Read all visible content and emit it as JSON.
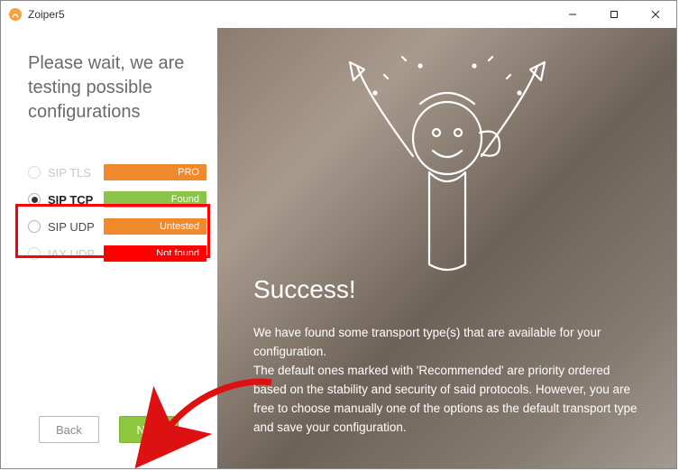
{
  "window": {
    "title": "Zoiper5"
  },
  "left": {
    "heading": "Please wait, we are testing possible configurations",
    "configs": [
      {
        "label": "SIP TLS",
        "status": "PRO",
        "color": "orange",
        "disabled": true,
        "selected": false
      },
      {
        "label": "SIP TCP",
        "status": "Found",
        "color": "green",
        "disabled": false,
        "selected": true
      },
      {
        "label": "SIP UDP",
        "status": "Untested",
        "color": "orange",
        "disabled": false,
        "selected": false
      },
      {
        "label": "IAX UDP",
        "status": "Not found",
        "color": "red",
        "disabled": true,
        "selected": false
      }
    ],
    "back_label": "Back",
    "next_label": "Next"
  },
  "right": {
    "title": "Success!",
    "body_line1": "We have found some transport type(s) that are available for your configuration.",
    "body_line2": "The default ones marked with 'Recommended' are priority ordered based on the stability and security of said protocols. However, you are free to choose manually one of the options as the default  transport type and save your configuration."
  }
}
